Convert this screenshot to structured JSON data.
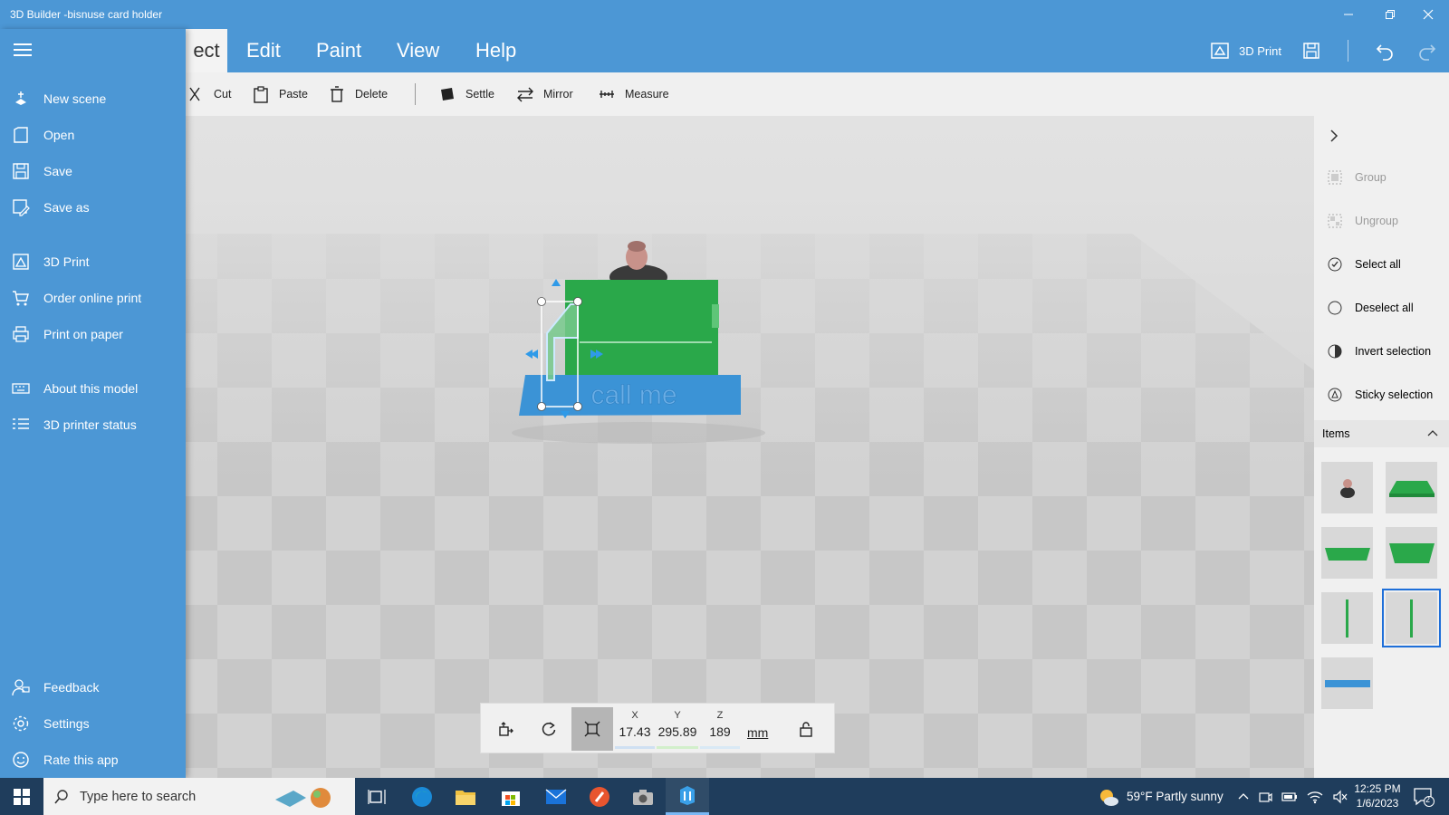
{
  "window": {
    "title": "3D Builder -bisnuse card holder",
    "minimize_icon": "minimize-icon",
    "restore_icon": "restore-icon",
    "close_icon": "close-icon"
  },
  "menu": {
    "tabs": [
      {
        "label": "ect",
        "active": true
      },
      {
        "label": "Edit"
      },
      {
        "label": "Paint"
      },
      {
        "label": "View"
      },
      {
        "label": "Help"
      }
    ],
    "print_label": "3D Print"
  },
  "toolbar": {
    "cut": "Cut",
    "paste": "Paste",
    "delete": "Delete",
    "settle": "Settle",
    "mirror": "Mirror",
    "measure": "Measure"
  },
  "nav": {
    "items": [
      {
        "label": "New scene",
        "icon": "new-scene-icon"
      },
      {
        "label": "Open",
        "icon": "open-icon"
      },
      {
        "label": "Save",
        "icon": "save-icon"
      },
      {
        "label": "Save as",
        "icon": "save-as-icon"
      },
      {
        "label": "3D Print",
        "icon": "3d-print-icon"
      },
      {
        "label": "Order online print",
        "icon": "cart-icon"
      },
      {
        "label": "Print on paper",
        "icon": "printer-icon"
      },
      {
        "label": "About this model",
        "icon": "keyboard-icon"
      },
      {
        "label": "3D printer status",
        "icon": "list-icon"
      }
    ],
    "bottom": [
      {
        "label": "Feedback",
        "icon": "feedback-icon"
      },
      {
        "label": "Settings",
        "icon": "settings-icon"
      },
      {
        "label": "Rate this app",
        "icon": "smiley-icon"
      }
    ]
  },
  "scene": {
    "model_text": "call me"
  },
  "coords": {
    "x_label": "X",
    "x_value": "17.43",
    "y_label": "Y",
    "y_value": "295.89",
    "z_label": "Z",
    "z_value": "189",
    "unit": "mm"
  },
  "right_pane": {
    "group": "Group",
    "ungroup": "Ungroup",
    "select_all": "Select all",
    "deselect_all": "Deselect all",
    "invert_selection": "Invert selection",
    "sticky_selection": "Sticky selection",
    "items_title": "Items"
  },
  "taskbar": {
    "search_placeholder": "Type here to search",
    "weather": "59°F  Partly sunny",
    "time": "12:25 PM",
    "date": "1/6/2023",
    "notification_count": "2"
  },
  "colors": {
    "accent": "#4c97d5",
    "model_green": "#2aa84a",
    "model_blue": "#3b93d6",
    "taskbar": "#1f3d5c"
  }
}
